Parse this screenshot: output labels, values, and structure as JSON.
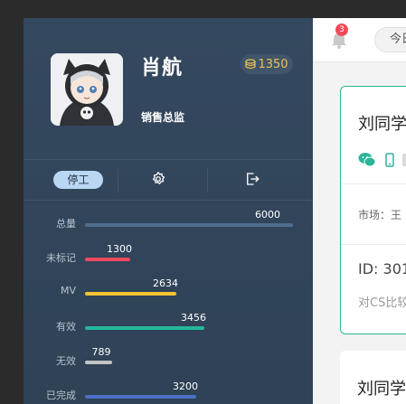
{
  "profile": {
    "name": "肖航",
    "role": "销售总监",
    "coins": "1350",
    "avatar_icon": "anime-avatar"
  },
  "actions": {
    "stop_label": "停工",
    "settings_icon": "gear-icon",
    "logout_icon": "logout-icon"
  },
  "stats": [
    {
      "label": "总量",
      "value": "6000",
      "color": "#4f6d8e"
    },
    {
      "label": "未标记",
      "value": "1300",
      "color": "#ef4a62"
    },
    {
      "label": "MV",
      "value": "2634",
      "color": "#f6c232"
    },
    {
      "label": "有效",
      "value": "3456",
      "color": "#25b89b"
    },
    {
      "label": "无效",
      "value": "789",
      "color": "#c4c4c4"
    },
    {
      "label": "已完成",
      "value": "3200",
      "color": "#4a6fc4"
    }
  ],
  "topbar": {
    "notification_count": "3",
    "tab_label": "今日"
  },
  "card": {
    "title": "刘同学",
    "market": "市场：王",
    "id_text": "ID: 301",
    "note": "对CS比较"
  },
  "card2": {
    "title": "刘同学"
  }
}
